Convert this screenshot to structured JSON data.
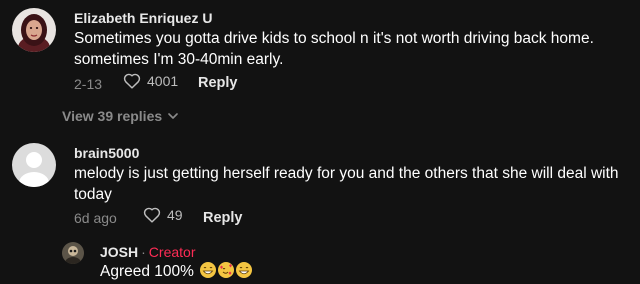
{
  "comments": [
    {
      "username": "Elizabeth Enriquez U",
      "text": "Sometimes you gotta drive kids to school n it's not worth driving back home. sometimes I'm 30-40min early.",
      "date": "2-13",
      "likes": "4001",
      "reply_label": "Reply",
      "view_replies_label": "View 39 replies"
    },
    {
      "username": "brain5000",
      "text": "melody is just getting herself ready for you and the others that she will deal with today",
      "date": "6d ago",
      "likes": "49",
      "reply_label": "Reply"
    }
  ],
  "reply": {
    "username": "JOSH",
    "separator": "·",
    "tag": "Creator",
    "text": "Agreed 100%",
    "emojis": [
      "grin-face-emoji",
      "smiling-hearts-face-emoji",
      "grin-face-emoji"
    ]
  },
  "colors": {
    "background": "#121212",
    "creator": "#fe2c55",
    "muted": "#8a8a8a"
  }
}
